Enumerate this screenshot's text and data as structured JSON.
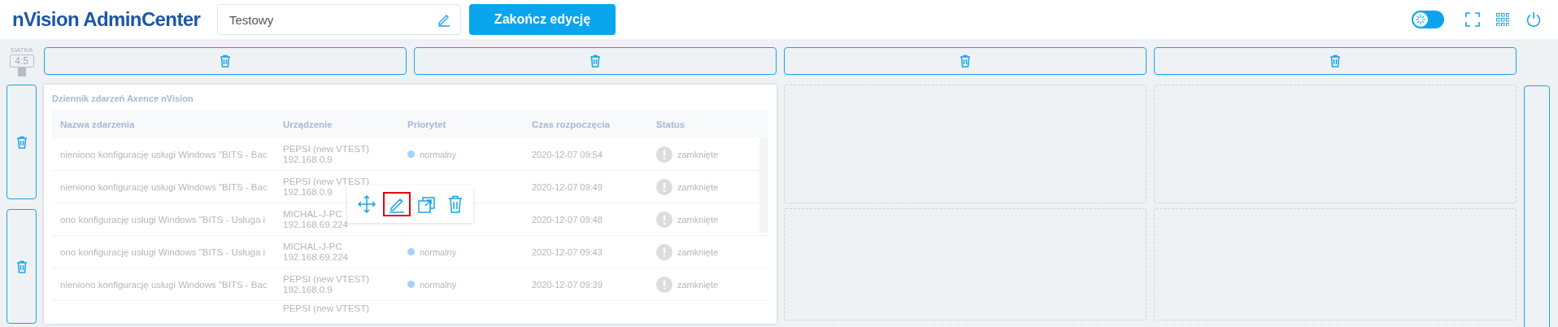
{
  "header": {
    "logo": "nVision AdminCenter",
    "name_field": {
      "value": "Testowy"
    },
    "finish_button": "Zakończ edycję",
    "theme_toggle": {
      "on": true
    }
  },
  "grid": {
    "label": "SIATKA",
    "ratio": "4:5"
  },
  "widget": {
    "title": "Dziennik zdarzeń Axence nVision",
    "columns": [
      "Nazwa zdarzenia",
      "Urządzenie",
      "Priorytet",
      "Czas rozpoczęcia",
      "Status"
    ],
    "rows": [
      {
        "event": "nieniono konfigurację usługi Windows \"BITS - Bac",
        "device": "PEPSI (new VTEST)",
        "address": "192.168.0.9",
        "priority": "normalny",
        "time": "2020-12-07 09:54",
        "status": "zamknięte"
      },
      {
        "event": "nieniono konfigurację usługi Windows \"BITS - Bac",
        "device": "PEPSI (new VTEST)",
        "address": "192.168.0.9",
        "time": "2020-12-07 09:49",
        "status": "zamknięte"
      },
      {
        "event": "ono konfigurację usługi Windows \"BITS - Usługa i",
        "device": "MICHAL-J-PC",
        "address": "192.168.69.224",
        "time": "2020-12-07 09:48",
        "status": "zamknięte"
      },
      {
        "event": "ono konfigurację usługi Windows \"BITS - Usługa i",
        "device": "MICHAL-J-PC",
        "address": "192.168.69.224",
        "priority": "normalny",
        "time": "2020-12-07 09:43",
        "status": "zamknięte"
      },
      {
        "event": "nieniono konfigurację usługi Windows \"BITS - Bac",
        "device": "PEPSI (new VTEST)",
        "address": "192.168.0.9",
        "priority": "normalny",
        "time": "2020-12-07 09:39",
        "status": "zamknięte"
      },
      {
        "device": "PEPSI (new VTEST)"
      }
    ],
    "toolbar": [
      {
        "kind": "move",
        "selected": false
      },
      {
        "kind": "edit",
        "selected": true
      },
      {
        "kind": "popout",
        "selected": false
      },
      {
        "kind": "delete",
        "selected": false
      }
    ]
  }
}
